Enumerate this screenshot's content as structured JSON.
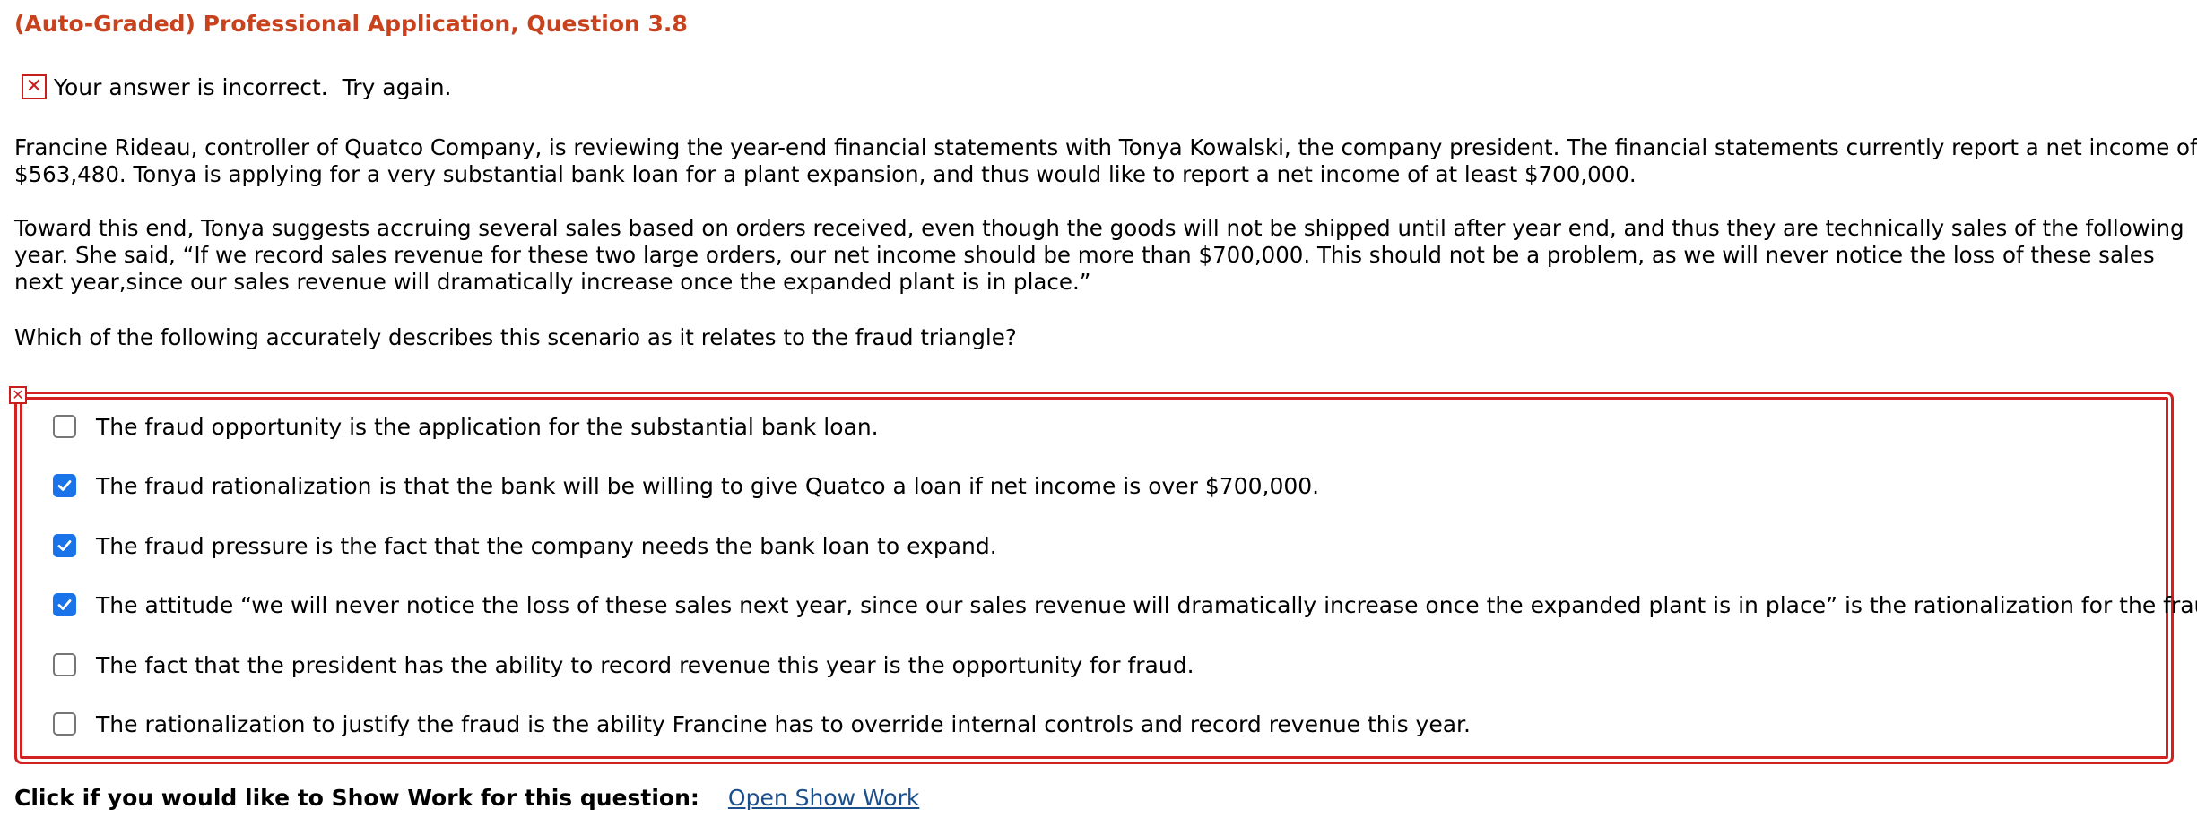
{
  "question_title": "(Auto-Graded) Professional Application, Question 3.8",
  "feedback": {
    "icon": "x-mark-icon",
    "text": "Your answer is incorrect.  Try again.",
    "color": "#c81e1e"
  },
  "scenario": {
    "paragraph1_lines": [
      "Francine Rideau, controller of Quatco Company, is reviewing the year-end financial statements with Tonya Kowalski, the company president. The financial statements currently report a net income of",
      "$563,480. Tonya is applying for a very substantial bank loan for a plant expansion, and thus would like to report a net income of at least $700,000."
    ],
    "paragraph2_lines": [
      "Toward this end, Tonya suggests accruing several sales based on orders received, even though the goods will not be shipped until after year end, and thus they are technically sales of the following",
      "year. She said, “If we record sales revenue for these two large orders, our net income should be more than $700,000. This should not be a problem, as we will never notice the loss of these sales",
      "next year,since our sales revenue will dramatically increase once the expanded plant is in place.”"
    ],
    "prompt": "Which of the following accurately describes this scenario as it relates to the fraud triangle?"
  },
  "options": [
    {
      "label": "The fraud opportunity is the application for the substantial bank loan.",
      "checked": false
    },
    {
      "label": "The fraud rationalization is that the bank will be willing to give Quatco a loan if net income is over $700,000.",
      "checked": true
    },
    {
      "label": "The fraud pressure is the fact that the company needs the bank loan to expand.",
      "checked": true
    },
    {
      "label": "The attitude “we will never notice the loss of these sales next year, since our sales revenue will dramatically increase once the expanded plant is in place” is the rationalization for the fraud.",
      "checked": true
    },
    {
      "label": "The fact that the president has the ability to record revenue this year is the opportunity for fraud.",
      "checked": false
    },
    {
      "label": "The rationalization to justify the fraud is the ability Francine has to override internal controls and record revenue this year.",
      "checked": false
    }
  ],
  "show_work": {
    "label": "Click if you would like to Show Work for this question:",
    "link": "Open Show Work"
  },
  "colors": {
    "title": "#c8421e",
    "error": "#d32020",
    "checkbox_checked": "#1a73e8",
    "link": "#1a4f8b"
  }
}
